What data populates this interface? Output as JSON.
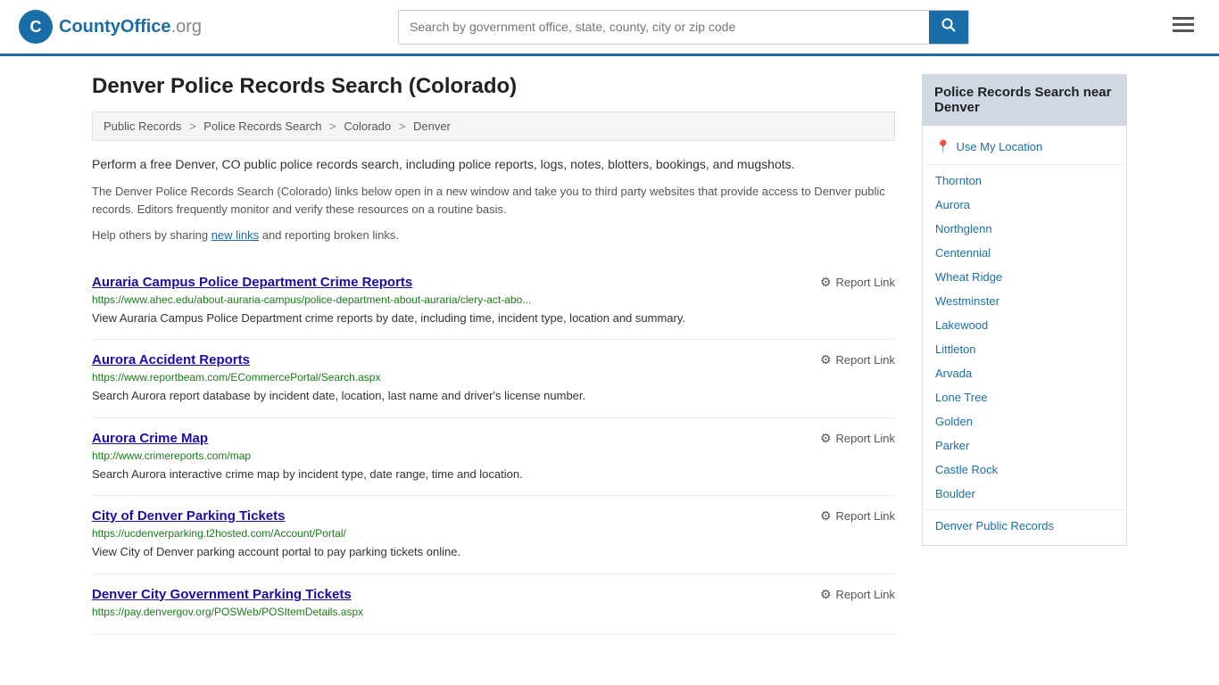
{
  "header": {
    "logo_text": "CountyOffice",
    "logo_suffix": ".org",
    "search_placeholder": "Search by government office, state, county, city or zip code",
    "search_button_label": "🔍"
  },
  "page": {
    "title": "Denver Police Records Search (Colorado)",
    "breadcrumb": {
      "items": [
        "Public Records",
        "Police Records Search",
        "Colorado",
        "Denver"
      ]
    },
    "intro": {
      "p1": "Perform a free Denver, CO public police records search, including police reports, logs, notes, blotters, bookings, and mugshots.",
      "p2": "The Denver Police Records Search (Colorado) links below open in a new window and take you to third party websites that provide access to Denver public records. Editors frequently monitor and verify these resources on a routine basis.",
      "p3_before": "Help others by sharing ",
      "p3_link": "new links",
      "p3_after": " and reporting broken links."
    },
    "results": [
      {
        "title": "Auraria Campus Police Department Crime Reports",
        "url": "https://www.ahec.edu/about-auraria-campus/police-department-about-auraria/clery-act-abo...",
        "desc": "View Auraria Campus Police Department crime reports by date, including time, incident type, location and summary.",
        "report_label": "Report Link"
      },
      {
        "title": "Aurora Accident Reports",
        "url": "https://www.reportbeam.com/ECommercePortal/Search.aspx",
        "desc": "Search Aurora report database by incident date, location, last name and driver's license number.",
        "report_label": "Report Link"
      },
      {
        "title": "Aurora Crime Map",
        "url": "http://www.crimereports.com/map",
        "desc": "Search Aurora interactive crime map by incident type, date range, time and location.",
        "report_label": "Report Link"
      },
      {
        "title": "City of Denver Parking Tickets",
        "url": "https://ucdenverparking.t2hosted.com/Account/Portal/",
        "desc": "View City of Denver parking account portal to pay parking tickets online.",
        "report_label": "Report Link"
      },
      {
        "title": "Denver City Government Parking Tickets",
        "url": "https://pay.denvergov.org/POSWeb/POSItemDetails.aspx",
        "desc": "",
        "report_label": "Report Link"
      }
    ]
  },
  "sidebar": {
    "title": "Police Records Search near Denver",
    "use_my_location": "Use My Location",
    "links": [
      "Thornton",
      "Aurora",
      "Northglenn",
      "Centennial",
      "Wheat Ridge",
      "Westminster",
      "Lakewood",
      "Littleton",
      "Arvada",
      "Lone Tree",
      "Golden",
      "Parker",
      "Castle Rock",
      "Boulder"
    ],
    "bottom_label": "Denver Public Records"
  }
}
